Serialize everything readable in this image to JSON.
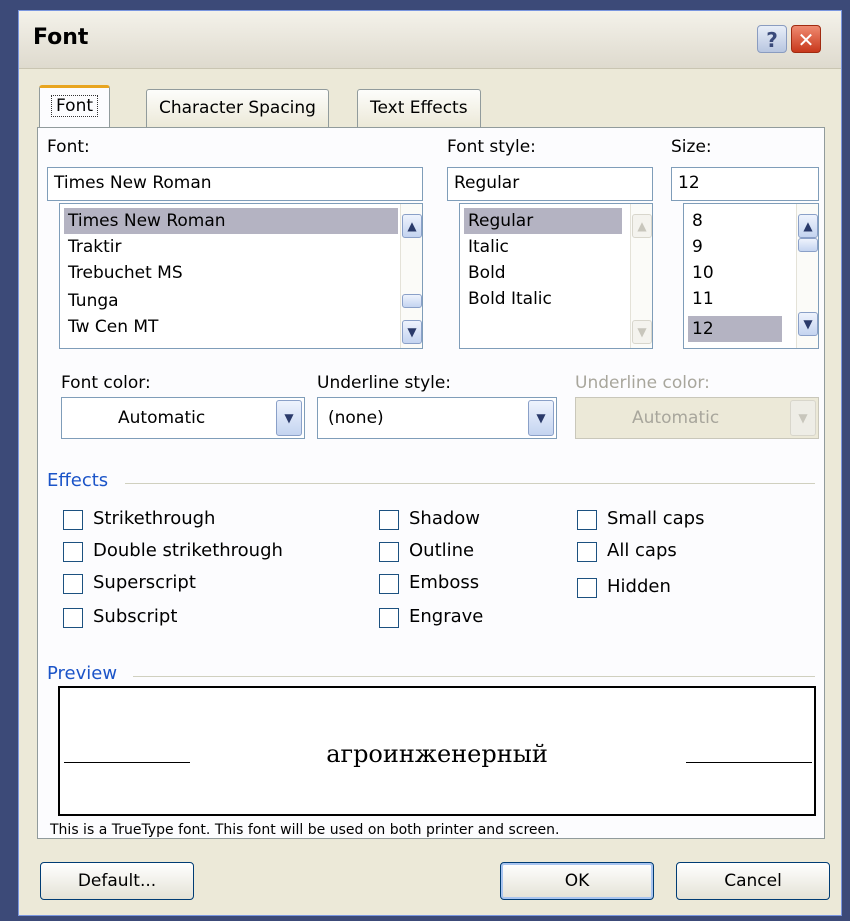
{
  "dialog": {
    "title": "Font",
    "help_icon": "question-mark-icon",
    "close_icon": "close-x-icon"
  },
  "tabs": [
    {
      "label": "Font",
      "active": true
    },
    {
      "label": "Character Spacing",
      "active": false
    },
    {
      "label": "Text Effects",
      "active": false
    }
  ],
  "font": {
    "label": "Font:",
    "value": "Times New Roman",
    "items": [
      "Times New Roman",
      "Traktir",
      "Trebuchet MS",
      "Tunga",
      "Tw Cen MT"
    ],
    "selected_index": 0
  },
  "font_style": {
    "label": "Font style:",
    "value": "Regular",
    "items": [
      "Regular",
      "Italic",
      "Bold",
      "Bold Italic"
    ],
    "selected_index": 0
  },
  "size": {
    "label": "Size:",
    "value": "12",
    "items": [
      "8",
      "9",
      "10",
      "11",
      "12"
    ],
    "selected_index": 4
  },
  "font_color": {
    "label": "Font color:",
    "value": "Automatic"
  },
  "underline_style": {
    "label": "Underline style:",
    "value": "(none)"
  },
  "underline_color": {
    "label": "Underline color:",
    "value": "Automatic",
    "disabled": true
  },
  "effects": {
    "title": "Effects",
    "col1": [
      {
        "label": "Strikethrough",
        "checked": false
      },
      {
        "label": "Double strikethrough",
        "checked": false
      },
      {
        "label": "Superscript",
        "checked": false
      },
      {
        "label": "Subscript",
        "checked": false
      }
    ],
    "col2": [
      {
        "label": "Shadow",
        "checked": false
      },
      {
        "label": "Outline",
        "checked": false
      },
      {
        "label": "Emboss",
        "checked": false
      },
      {
        "label": "Engrave",
        "checked": false
      }
    ],
    "col3": [
      {
        "label": "Small caps",
        "checked": false
      },
      {
        "label": "All caps",
        "checked": false
      },
      {
        "label": "Hidden",
        "checked": false
      }
    ]
  },
  "preview": {
    "title": "Preview",
    "sample": "агроинженерный",
    "note": "This is a TrueType font. This font will be used on both printer and screen."
  },
  "buttons": {
    "default": "Default...",
    "ok": "OK",
    "cancel": "Cancel"
  },
  "colors": {
    "accent": "#1b54c8",
    "tab_highlight": "#e8a520",
    "selection": "#b4b3c2",
    "close": "#c8381c"
  }
}
